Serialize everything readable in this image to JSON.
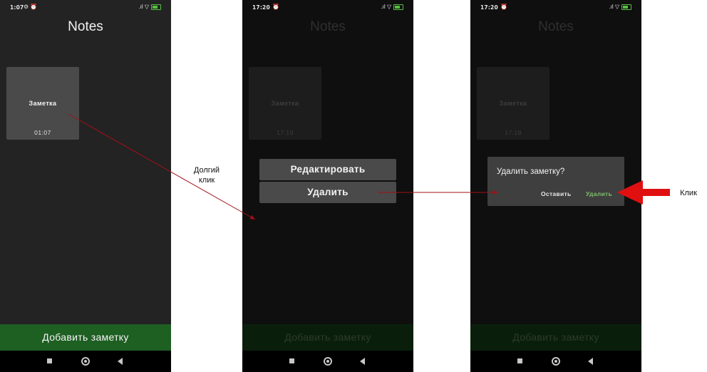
{
  "screens": [
    {
      "status": {
        "time": "1:07",
        "icons": "⚙ ⏰",
        "right_icons": ".ıl ▽"
      },
      "title": "Notes",
      "note": {
        "title": "Заметка",
        "date": "01:07"
      },
      "add_button": "Добавить заметку"
    },
    {
      "status": {
        "time": "17:20",
        "icons": "⏰",
        "right_icons": ".ıl ▽"
      },
      "title": "Notes",
      "note": {
        "title": "Заметка",
        "date": "17:19"
      },
      "menu": {
        "edit": "Редактировать",
        "delete": "Удалить"
      },
      "add_button": "Добавить заметку"
    },
    {
      "status": {
        "time": "17:20",
        "icons": "⏰",
        "right_icons": ".ıl ▽"
      },
      "title": "Notes",
      "note": {
        "title": "Заметка",
        "date": "17:19"
      },
      "dialog": {
        "title": "Удалить заметку?",
        "cancel": "Оставить",
        "confirm": "Удалить"
      },
      "add_button": "Добавить заметку"
    }
  ],
  "annotations": {
    "long_click_line1": "Долгий",
    "long_click_line2": "клик",
    "click": "Клик"
  },
  "colors": {
    "arrow_line": "#a01018",
    "arrow_fill": "#e01010",
    "add_button": "#1e5f22",
    "confirm": "#7ec06a"
  }
}
